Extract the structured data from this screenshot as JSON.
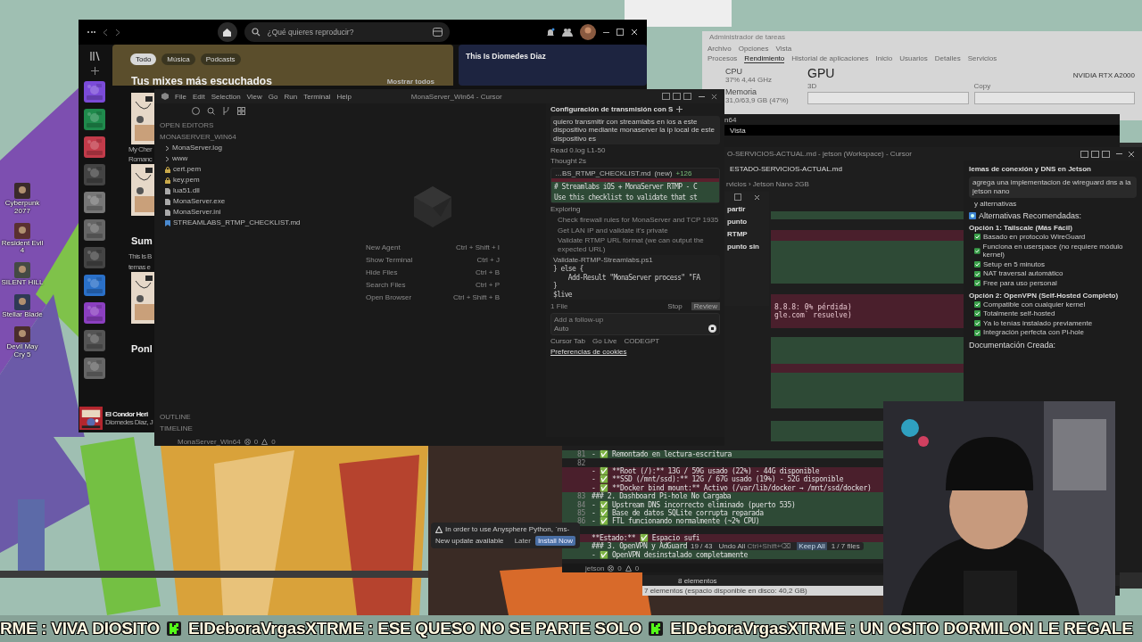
{
  "desktop_icons": [
    {
      "label": "Cyberpunk 2077"
    },
    {
      "label": "Resident Evil 4"
    },
    {
      "label": "SILENT HILL"
    },
    {
      "label": "Stellar Blade"
    },
    {
      "label": "Devil May Cry 5"
    }
  ],
  "task_manager": {
    "title": "Administrador de tareas",
    "menu": [
      "Archivo",
      "Opciones",
      "Vista"
    ],
    "tabs": [
      {
        "label": "Procesos",
        "selected": false
      },
      {
        "label": "Rendimiento",
        "selected": true
      },
      {
        "label": "Historial de aplicaciones",
        "selected": false
      },
      {
        "label": "Inicio",
        "selected": false
      },
      {
        "label": "Usuarios",
        "selected": false
      },
      {
        "label": "Detalles",
        "selected": false
      },
      {
        "label": "Servicios",
        "selected": false
      }
    ],
    "resources": [
      {
        "name": "CPU",
        "detail": "37% 4,44 GHz"
      },
      {
        "name": "Memoria",
        "detail": "31,0/63,9 GB (47%)"
      }
    ],
    "heading": "GPU",
    "device": "NVIDIA RTX A2000",
    "graphs": [
      "3D",
      "Copy"
    ]
  },
  "explorer": {
    "title": "n64",
    "ribbon": "Vista",
    "status": "8 elementos",
    "status_other": "7 elementos (espacio disponible en disco: 40,2 GB)"
  },
  "spotify": {
    "search_placeholder": "¿Qué quieres reproducir?",
    "filters": [
      {
        "label": "Todo",
        "selected": true
      },
      {
        "label": "Música",
        "selected": false
      },
      {
        "label": "Podcasts",
        "selected": false
      }
    ],
    "section_title": "Tus mixes más escuchados",
    "show_all": "Mostrar todos",
    "feature_title": "This Is Diomedes Diaz",
    "peek": [
      {
        "kind": "caption",
        "text": "My Cher"
      },
      {
        "kind": "caption",
        "text": "Romanc"
      },
      {
        "kind": "section",
        "text": "Sum"
      },
      {
        "kind": "caption",
        "text": "This Is B"
      },
      {
        "kind": "caption",
        "text": "temas e"
      },
      {
        "kind": "section",
        "text": "Ponl"
      }
    ],
    "now_playing": {
      "title": "El Condor Heri",
      "artist": "Diomedes Diaz, J"
    }
  },
  "cursor_main": {
    "menu": [
      "File",
      "Edit",
      "Selection",
      "View",
      "Go",
      "Run",
      "Terminal",
      "Help"
    ],
    "title": "MonaServer_Win64 - Cursor",
    "sections": [
      "OPEN EDITORS",
      "MONASERVER_WIN64"
    ],
    "files": [
      {
        "name": "MonaServer.log",
        "kind": "folder"
      },
      {
        "name": "www",
        "kind": "folder"
      },
      {
        "name": "cert.pem",
        "kind": "key"
      },
      {
        "name": "key.pem",
        "kind": "key"
      },
      {
        "name": "lua51.dll",
        "kind": "file"
      },
      {
        "name": "MonaServer.exe",
        "kind": "file"
      },
      {
        "name": "MonaServer.ini",
        "kind": "file"
      },
      {
        "name": "STREAMLABS_RTMP_CHECKLIST.md",
        "kind": "markdown"
      }
    ],
    "shortcuts": [
      {
        "label": "New Agent",
        "keys": "Ctrl + Shift + I"
      },
      {
        "label": "Show Terminal",
        "keys": "Ctrl + J"
      },
      {
        "label": "Hide Files",
        "keys": "Ctrl + B"
      },
      {
        "label": "Search Files",
        "keys": "Ctrl + P"
      },
      {
        "label": "Open Browser",
        "keys": "Ctrl + Shift + B"
      }
    ],
    "bottom_sections": [
      "OUTLINE",
      "TIMELINE"
    ],
    "status": {
      "folder": "MonaServer_Win64",
      "errors": "0",
      "warnings": "0"
    },
    "chat": {
      "title": "Configuración de transmisión con S",
      "prompt": "quiero transmitir con streamlabs en ios a este dispositivo mediante monaserver la ip local de este dispositivo es",
      "steps": [
        "Read 0.log L1-50",
        "Thought 2s"
      ],
      "diff_file": "…BS_RTMP_CHECKLIST.md",
      "diff_tag": "(new)",
      "diff_count": "+126",
      "diff_lines": [
        "# Streamlabs iOS + MonaServer RTMP - C",
        "Use this checklist to validate that st"
      ],
      "exploring": "Exploring",
      "explore_items": [
        "Check firewall rules for MonaServer and TCP 1935",
        "Get LAN IP and validate it's private",
        "Validate RTMP URL format (we can output the expected URL)"
      ],
      "running": "Validate-RTMP-Streamlabs.ps1",
      "code": [
        "} else {",
        "    Add-Result \"MonaServer process\" \"FA",
        "}",
        "$live"
      ],
      "files_count": "1 File",
      "stop": "Stop",
      "review": "Review",
      "placeholder": "Add a follow-up",
      "mode": "Auto",
      "footer": [
        "Cursor Tab",
        "Go Live",
        "CODEGPT"
      ],
      "cookies": "Preferencias de cookies"
    }
  },
  "cursor_jetson": {
    "title": "O-SERVICIOS-ACTUAL.md - jetson (Workspace) - Cursor",
    "tab": "ESTADO-SERVICIOS-ACTUAL.md",
    "breadcrumb": "rvicios › Jetson Nano 2GB",
    "fragments": [
      "8.8.8: 0% pérdida)",
      "gle.com` resuelve)"
    ],
    "code": [
      {
        "num": "81",
        "kind": "added",
        "text": "- ✅ Remontado en lectura-escritura"
      },
      {
        "num": "82",
        "kind": "blank"
      },
      {
        "kind": "removed",
        "text": "- ✅ **Root (/):** 13G / 59G usado (22%) - 44G disponible"
      },
      {
        "kind": "removed",
        "text": "- ✅ **SSD (/mnt/ssd):** 12G / 67G usado (19%) - 52G disponible"
      },
      {
        "kind": "removed",
        "text": "- ✅ **Docker bind mount:** Activo (/var/lib/docker → /mnt/ssd/docker)"
      },
      {
        "num": "83",
        "kind": "added",
        "text": "### 2. Dashboard Pi-hole No Cargaba"
      },
      {
        "num": "84",
        "kind": "added",
        "text": "- ✅ Upstream DNS incorrecto eliminado (puerto 535)"
      },
      {
        "num": "85",
        "kind": "added",
        "text": "- ✅ Base de datos SQLite corrupta reparada"
      },
      {
        "num": "86",
        "kind": "added",
        "text": "- ✅ FTL funcionando normalmente (~2% CPU)"
      },
      {
        "kind": "blank"
      },
      {
        "kind": "removed",
        "text": "**Estado:** ✅ Espacio sufi"
      },
      {
        "kind": "added",
        "text": "### 3. OpenVPN y AdGuard"
      },
      {
        "kind": "added",
        "text": "- ✅ OpenVPN desinstalado completamente"
      }
    ],
    "diff_bar": {
      "position": "19 / 43",
      "undo": "Undo All",
      "undo_keys": "Ctrl+Shift+⌫",
      "keep": "Keep All",
      "files": "1 / 7 files"
    },
    "status": {
      "folder": "jetson",
      "errors": "0",
      "warnings": "0"
    },
    "share_panel": [
      "partir",
      "punto",
      "RTMP",
      "punto sin"
    ],
    "chat": {
      "title": "lemas de conexión y DNS en Jetson",
      "prompt": "agrega una implementacion de wireguard dns a la jetson nano",
      "carry": "y alternativas",
      "heading": "Alternativas Recomendadas:",
      "options": [
        {
          "title": "Opción 1: Tailscale (Más Fácil)",
          "items": [
            "Basado en protocolo WireGuard",
            "Funciona en userspace (no requiere módulo kernel)",
            "Setup en 5 minutos",
            "NAT traversal automático",
            "Free para uso personal"
          ]
        },
        {
          "title": "Opción 2: OpenVPN (Self-Hosted Completo)",
          "items": [
            "Compatible con cualquier kernel",
            "Totalmente self-hosted",
            "Ya lo tenías instalado previamente",
            "Integración perfecta con Pi-hole"
          ]
        }
      ],
      "docs": "Documentación Creada:"
    }
  },
  "toast": {
    "message": "In order to use Anysphere Python, `ms-",
    "update": "New update available",
    "later": "Later",
    "install": "Install Now"
  },
  "ticker": [
    "RME : VIVA DIOSITO",
    "ElDeboraVrgasXTRME : ESE QUESO NO SE PARTE SOLO",
    "ElDeboraVrgasXTRME : UN OSITO DORMILON LE REGALE"
  ]
}
